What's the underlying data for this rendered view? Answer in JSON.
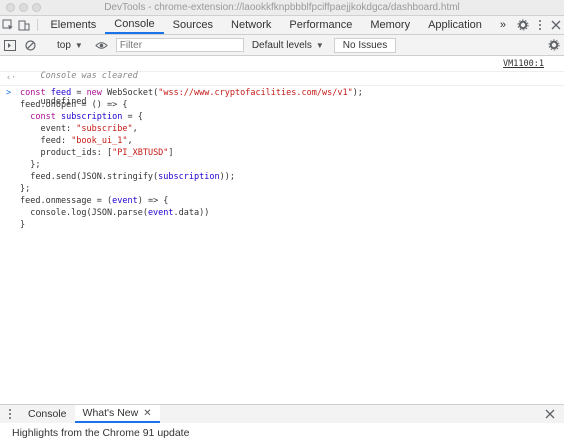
{
  "window": {
    "title": "DevTools - chrome-extension://laookkfknpbbblfpciffpaejjkokdgca/dashboard.html"
  },
  "tabs": [
    "Elements",
    "Console",
    "Sources",
    "Network",
    "Performance",
    "Memory",
    "Application"
  ],
  "active_tab": "Console",
  "overflow_label": "»",
  "toolbar": {
    "context": "top",
    "filter_placeholder": "Filter",
    "levels_label": "Default levels",
    "issues_label": "No Issues"
  },
  "console": {
    "cleared_text": "Console was cleared",
    "cleared_source": "VM1100:1",
    "undefined_text": "undefined",
    "code": {
      "l1_a": "const ",
      "l1_b": "feed",
      "l1_c": " = ",
      "l1_d": "new",
      "l1_e": " WebSocket(",
      "l1_f": "\"wss://www.cryptofacilities.com/ws/v1\"",
      "l1_g": ");",
      "l2": "feed.onopen = () => {",
      "l3_a": "  const ",
      "l3_b": "subscription",
      "l3_c": " = {",
      "l4_a": "    event: ",
      "l4_b": "\"subscribe\"",
      "l4_c": ",",
      "l5_a": "    feed: ",
      "l5_b": "\"book_ui_1\"",
      "l5_c": ",",
      "l6_a": "    product_ids: [",
      "l6_b": "\"PI_XBTUSD\"",
      "l6_c": "]",
      "l7": "  };",
      "l8_a": "  feed.send(JSON.stringify(",
      "l8_b": "subscription",
      "l8_c": "));",
      "l9": "};",
      "l10_a": "feed.onmessage = (",
      "l10_b": "event",
      "l10_c": ") => {",
      "l11_a": "  console.log(JSON.parse(",
      "l11_b": "event",
      "l11_c": ".data))",
      "l12": "}"
    }
  },
  "drawer": {
    "tabs": [
      "Console",
      "What's New"
    ],
    "active_tab": "What's New",
    "highlights_text": "Highlights from the Chrome 91 update"
  }
}
